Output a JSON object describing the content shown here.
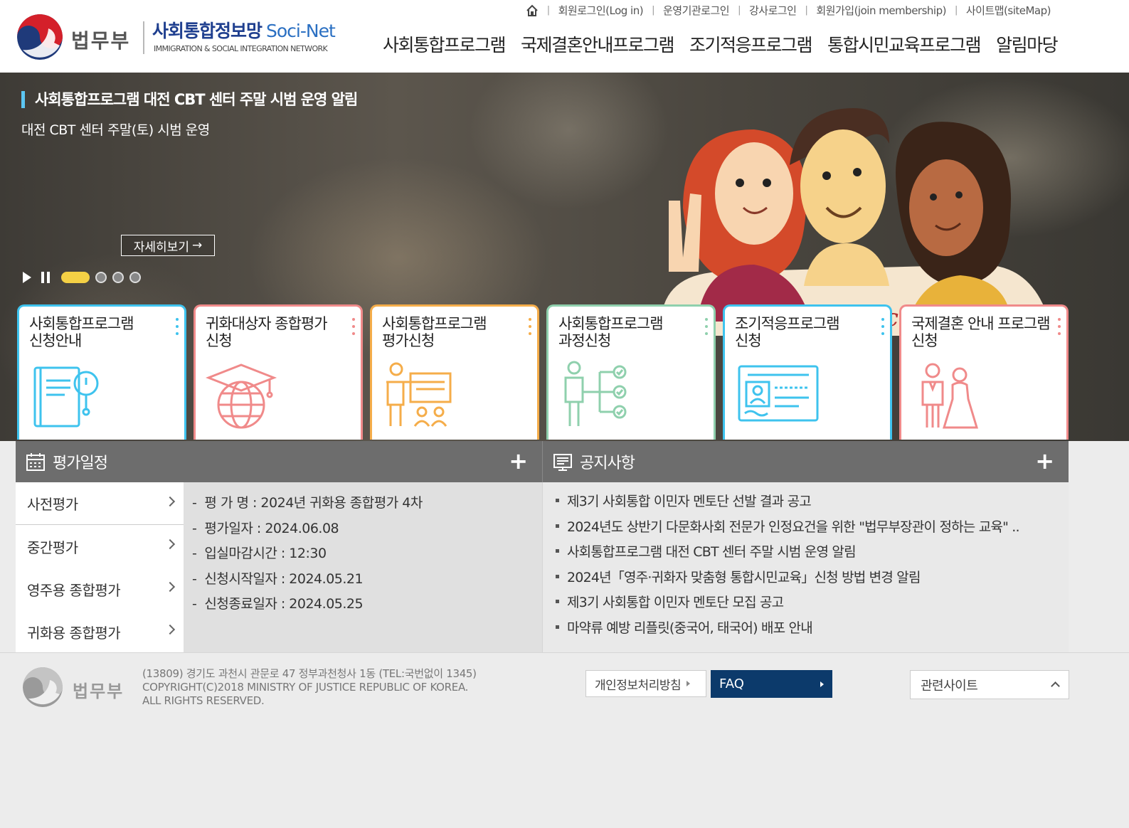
{
  "header": {
    "ministry": "법무부",
    "title_kr": "사회통합정보망",
    "title_en": "Soci-Net",
    "subtitle": "IMMIGRATION & SOCIAL INTEGRATION NETWORK",
    "util_links": [
      "회원로그인(Log in)",
      "운영기관로그인",
      "강사로그인",
      "회원가입(join membership)",
      "사이트맵(siteMap)"
    ],
    "nav": [
      "사회통합프로그램",
      "국제결혼안내프로그램",
      "조기적응프로그램",
      "통합시민교육프로그램",
      "알림마당"
    ]
  },
  "hero": {
    "title": "사회통합프로그램 대전 CBT 센터 주말 시범 운영 알림",
    "subtitle": "대전 CBT 센터 주말(토) 시범 운영",
    "more_label": "자세히보기",
    "sign_text": "사회통합정보망 Soci-Net",
    "slides": 4,
    "active_slide": 1
  },
  "quick_cards": [
    {
      "title": "사회통합프로그램\n신청안내",
      "icon": "book-info-icon",
      "color": "#3ec3ee"
    },
    {
      "title": "귀화대상자 종합평가\n신청",
      "icon": "graduation-globe-icon",
      "color": "#f08a8a"
    },
    {
      "title": "사회통합프로그램\n평가신청",
      "icon": "presentation-icon",
      "color": "#f5ad4a"
    },
    {
      "title": "사회통합프로그램\n과정신청",
      "icon": "checklist-person-icon",
      "color": "#8fd0ad"
    },
    {
      "title": "조기적응프로그램\n신청",
      "icon": "id-card-icon",
      "color": "#3ec3ee"
    },
    {
      "title": "국제결혼 안내 프로그램\n신청",
      "icon": "couple-icon",
      "color": "#f08a8a"
    }
  ],
  "schedule": {
    "title": "평가일정",
    "tabs": [
      "사전평가",
      "중간평가",
      "영주용 종합평가",
      "귀화용 종합평가"
    ],
    "active_tab": 0,
    "rows": [
      "-  평 가 명 : 2024년 귀화용 종합평가 4차",
      "-  평가일자 : 2024.06.08",
      "-  입실마감시간 : 12:30",
      "-  신청시작일자 : 2024.05.21",
      "-  신청종료일자 : 2024.05.25"
    ]
  },
  "notices": {
    "title": "공지사항",
    "items": [
      "제3기 사회통합 이민자 멘토단 선발 결과 공고",
      "2024년도 상반기 다문화사회 전문가 인정요건을 위한 \"법무부장관이 정하는 교육\" ..",
      "사회통합프로그램 대전 CBT 센터 주말 시범 운영 알림",
      "2024년「영주·귀화자 맞춤형 통합시민교육」신청 방법 변경 알림",
      "제3기 사회통합 이민자 멘토단 모집 공고",
      "마약류 예방 리플릿(중국어, 태국어) 배포 안내"
    ]
  },
  "footer": {
    "ministry": "법무부",
    "address": "(13809) 경기도 과천시 관문로 47 정부과천청사 1동 (TEL:국번없이 1345)",
    "copyright1": "COPYRIGHT(C)2018 MINISTRY OF JUSTICE REPUBLIC OF KOREA.",
    "copyright2": "ALL RIGHTS RESERVED.",
    "privacy_label": "개인정보처리방침",
    "faq_label": "FAQ",
    "related_label": "관련사이트"
  }
}
